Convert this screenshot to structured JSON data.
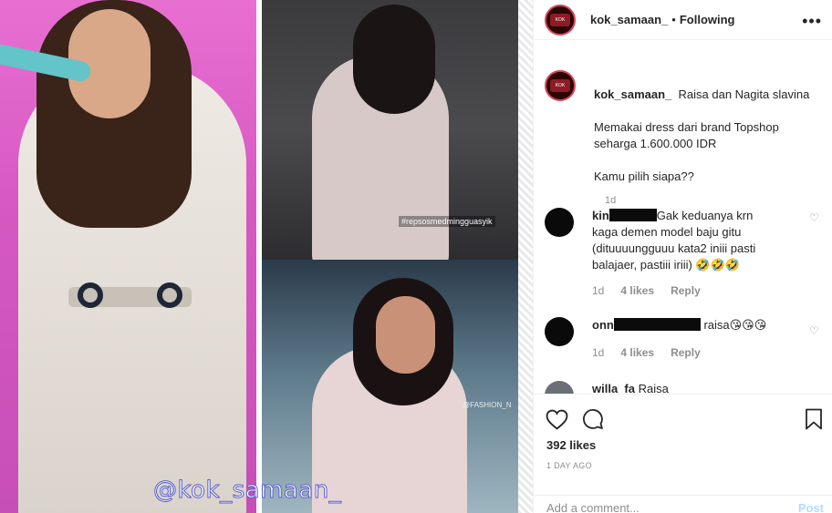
{
  "media": {
    "watermark": "@kok_samaan_",
    "hashtag": "#repsosmedmingguasyik",
    "overlay_bottom": "@FASHION_N"
  },
  "header": {
    "username": "kok_samaan_",
    "separator": "•",
    "follow_status": "Following",
    "avatar_text": "KOK SAMAAN"
  },
  "caption": {
    "username": "kok_samaan_",
    "lines": [
      "Raisa dan Nagita slavina",
      "",
      "Memakai dress dari brand Topshop",
      "seharga 1.600.000 IDR",
      "",
      "Kamu pilih siapa??"
    ],
    "time": "1d"
  },
  "comments": [
    {
      "username": "kin",
      "text_lines": [
        "Gak keduanya krn",
        "kaga demen model baju gitu",
        "(dituuuungguuu kata2 iniii pasti",
        "balajaer, pastiii iriii) 🤣🤣🤣"
      ],
      "time": "1d",
      "likes": "4 likes",
      "reply": "Reply"
    },
    {
      "username": "onn",
      "text_lines": [
        "raisa😘😘😘"
      ],
      "time": "1d",
      "likes": "4 likes",
      "reply": "Reply"
    },
    {
      "username": "willa_fa",
      "text_lines": [
        "Raisa"
      ]
    }
  ],
  "actions": {
    "likes": "392 likes",
    "time_ago": "1 DAY AGO",
    "comment_placeholder": "Add a comment...",
    "post_label": "Post"
  },
  "colors": {
    "link_blue_disabled": "#b3dbff",
    "muted_text": "#8e8e8e",
    "border": "#efefef"
  }
}
